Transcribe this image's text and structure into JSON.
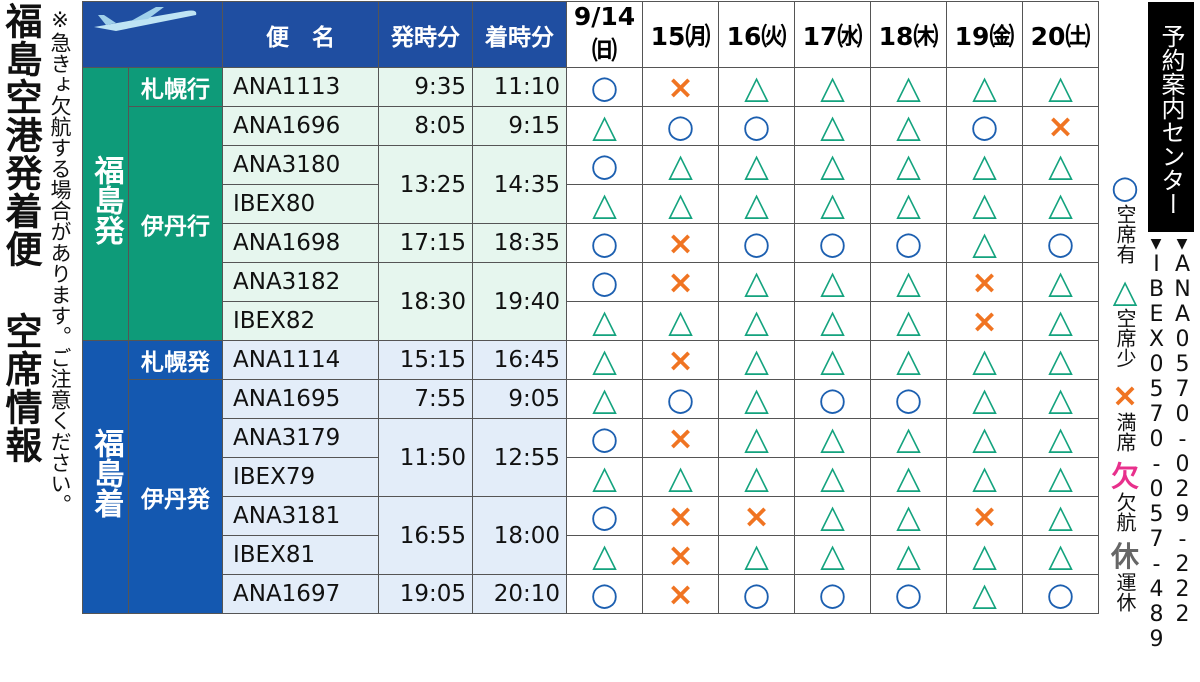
{
  "title": "福島空港発着便 空席情報",
  "note": "※急きょ欠航する場合があります。ご注意ください。",
  "sidebar": {
    "center_label": "予約案内センター",
    "phones": [
      {
        "airline": "ANA",
        "number": "0570-029-222"
      },
      {
        "airline": "IBEX",
        "number": "0570-057-489"
      }
    ]
  },
  "legend": [
    {
      "symbol": "○",
      "label": "空席有",
      "color": "#1c5fb0"
    },
    {
      "symbol": "△",
      "label": "空席少",
      "color": "#14a37e"
    },
    {
      "symbol": "×",
      "label": "満席",
      "color": "#f07422"
    },
    {
      "symbol": "欠",
      "label": "欠航",
      "color": "#e8308c"
    },
    {
      "symbol": "休",
      "label": "運休",
      "color": "#666666"
    }
  ],
  "table": {
    "headers": {
      "flight": "便　名",
      "dep": "発時分",
      "arr": "着時分"
    },
    "dates": [
      "9/14㈰",
      "15㈪",
      "16㈫",
      "17㈬",
      "18㈭",
      "19㈮",
      "20㈯"
    ],
    "departures": {
      "group": "福島発",
      "routes": [
        {
          "name": "札幌行",
          "rows": [
            {
              "flight": "ANA1113",
              "dep": "9:35",
              "arr": "11:10",
              "status": [
                "○",
                "×",
                "△",
                "△",
                "△",
                "△",
                "△"
              ]
            }
          ]
        },
        {
          "name": "伊丹行",
          "rows": [
            {
              "flight": "ANA1696",
              "dep": "8:05",
              "arr": "9:15",
              "status": [
                "△",
                "○",
                "○",
                "△",
                "△",
                "○",
                "×"
              ]
            },
            {
              "flight": "ANA3180",
              "dep": "13:25",
              "arr": "14:35",
              "status": [
                "○",
                "△",
                "△",
                "△",
                "△",
                "△",
                "△"
              ]
            },
            {
              "flight": "IBEX80",
              "dep": "",
              "arr": "",
              "status": [
                "△",
                "△",
                "△",
                "△",
                "△",
                "△",
                "△"
              ]
            },
            {
              "flight": "ANA1698",
              "dep": "17:15",
              "arr": "18:35",
              "status": [
                "○",
                "×",
                "○",
                "○",
                "○",
                "△",
                "○"
              ]
            },
            {
              "flight": "ANA3182",
              "dep": "18:30",
              "arr": "19:40",
              "status": [
                "○",
                "×",
                "△",
                "△",
                "△",
                "×",
                "△"
              ]
            },
            {
              "flight": "IBEX82",
              "dep": "",
              "arr": "",
              "status": [
                "△",
                "△",
                "△",
                "△",
                "△",
                "×",
                "△"
              ]
            }
          ]
        }
      ]
    },
    "arrivals": {
      "group": "福島着",
      "routes": [
        {
          "name": "札幌発",
          "rows": [
            {
              "flight": "ANA1114",
              "dep": "15:15",
              "arr": "16:45",
              "status": [
                "△",
                "×",
                "△",
                "△",
                "△",
                "△",
                "△"
              ]
            }
          ]
        },
        {
          "name": "伊丹発",
          "rows": [
            {
              "flight": "ANA1695",
              "dep": "7:55",
              "arr": "9:05",
              "status": [
                "△",
                "○",
                "△",
                "○",
                "○",
                "△",
                "△"
              ]
            },
            {
              "flight": "ANA3179",
              "dep": "11:50",
              "arr": "12:55",
              "status": [
                "○",
                "×",
                "△",
                "△",
                "△",
                "△",
                "△"
              ]
            },
            {
              "flight": "IBEX79",
              "dep": "",
              "arr": "",
              "status": [
                "△",
                "△",
                "△",
                "△",
                "△",
                "△",
                "△"
              ]
            },
            {
              "flight": "ANA3181",
              "dep": "16:55",
              "arr": "18:00",
              "status": [
                "○",
                "×",
                "×",
                "△",
                "△",
                "×",
                "△"
              ]
            },
            {
              "flight": "IBEX81",
              "dep": "",
              "arr": "",
              "status": [
                "△",
                "×",
                "△",
                "△",
                "△",
                "△",
                "△"
              ]
            },
            {
              "flight": "ANA1697",
              "dep": "19:05",
              "arr": "20:10",
              "status": [
                "○",
                "×",
                "○",
                "○",
                "○",
                "△",
                "○"
              ]
            }
          ]
        }
      ]
    }
  }
}
